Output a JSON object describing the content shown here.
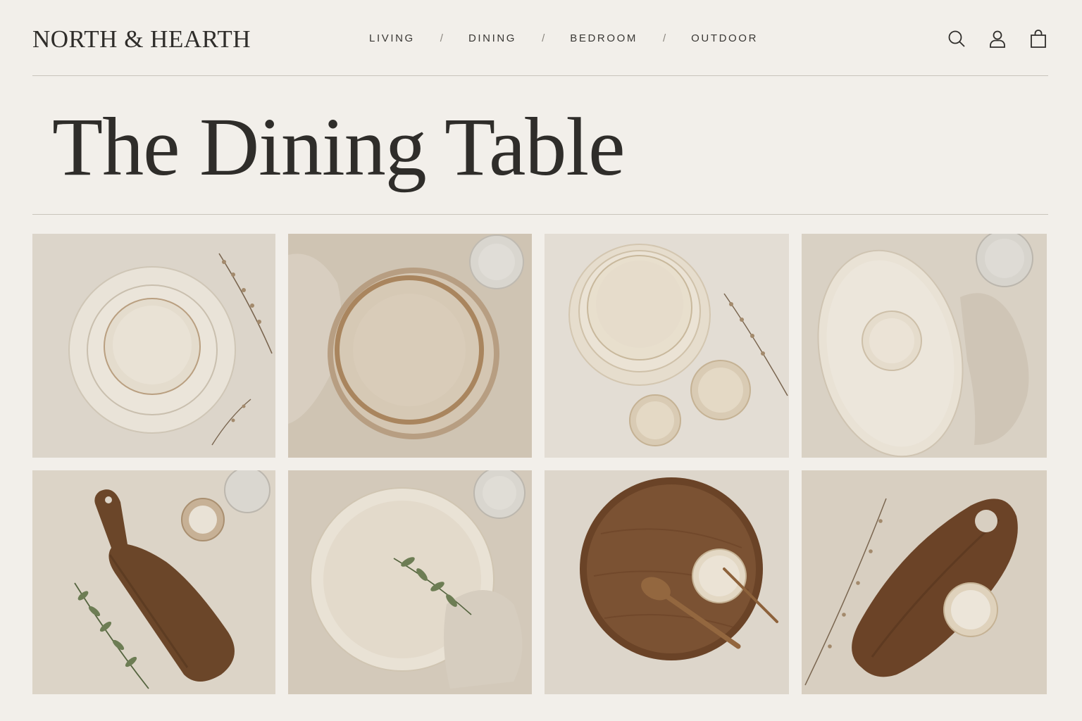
{
  "brand": {
    "name": "NORTH & HEARTH"
  },
  "nav": {
    "items": [
      {
        "label": "LIVING"
      },
      {
        "label": "DINING"
      },
      {
        "label": "BEDROOM"
      },
      {
        "label": "OUTDOOR"
      }
    ],
    "separator": "/"
  },
  "header_icons": [
    "search-icon",
    "account-icon",
    "shopping-bag-icon"
  ],
  "page": {
    "title": "The Dining Table"
  },
  "products": [
    {
      "image": "stacked-speckled-plates-and-bowl"
    },
    {
      "image": "brown-rimmed-stoneware-plates"
    },
    {
      "image": "stacked-bowls-with-small-cups"
    },
    {
      "image": "oval-platter-with-dip-bowl"
    },
    {
      "image": "wooden-paddle-board-with-salt-bowl"
    },
    {
      "image": "wide-speckled-serving-bowl"
    },
    {
      "image": "round-wooden-tray-with-spoon"
    },
    {
      "image": "oval-wooden-board-with-handle-hole"
    }
  ],
  "colors": {
    "background": "#f2efea",
    "text": "#2f2d2a",
    "rule": "#c9c4bc",
    "linen": "#d9d2c6",
    "ceramic": "#e8e1d4",
    "wood": "#6e4a2e"
  }
}
